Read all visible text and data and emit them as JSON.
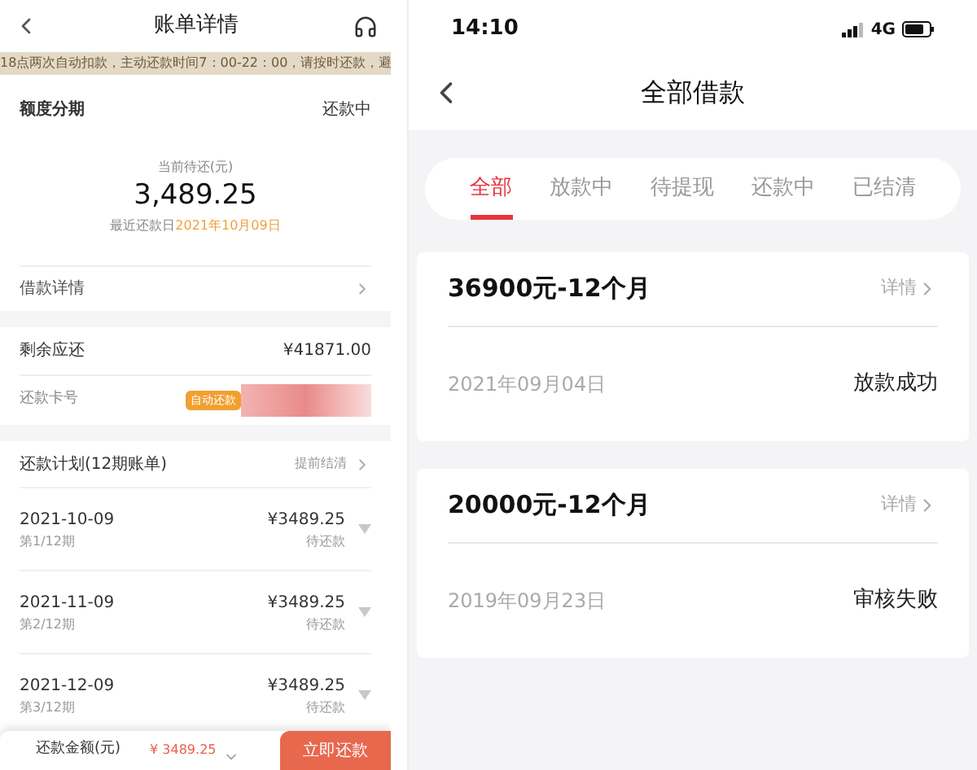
{
  "left": {
    "header": {
      "title": "账单详情"
    },
    "notice": "18点两次自动扣款，主动还款时间7：00-22：00，请按时还款，避",
    "summary": {
      "type": "额度分期",
      "status": "还款中",
      "label": "当前待还(元)",
      "amount": "3,489.25",
      "due_label": "最近还款日",
      "due_date": "2021年10月09日"
    },
    "loan_detail": "借款详情",
    "remaining": {
      "label": "剩余应还",
      "value": "¥41871.00"
    },
    "card": {
      "label": "还款卡号",
      "badge": "自动还款"
    },
    "plan": {
      "title": "还款计划(12期账单)",
      "action": "提前结清",
      "rows": [
        {
          "date": "2021-10-09",
          "period": "第1/12期",
          "amount": "¥3489.25",
          "status": "待还款"
        },
        {
          "date": "2021-11-09",
          "period": "第2/12期",
          "amount": "¥3489.25",
          "status": "待还款"
        },
        {
          "date": "2021-12-09",
          "period": "第3/12期",
          "amount": "¥3489.25",
          "status": "待还款"
        }
      ]
    },
    "footer": {
      "label": "还款金额(元)",
      "amount": "¥ 3489.25",
      "button": "立即还款"
    }
  },
  "right": {
    "status_bar": {
      "time": "14:10",
      "network": "4G"
    },
    "header": {
      "title": "全部借款"
    },
    "tabs": [
      {
        "label": "全部",
        "selected": true
      },
      {
        "label": "放款中",
        "selected": false
      },
      {
        "label": "待提现",
        "selected": false
      },
      {
        "label": "还款中",
        "selected": false
      },
      {
        "label": "已结清",
        "selected": false
      }
    ],
    "loans": [
      {
        "title": "36900元-12个月",
        "detail": "详情",
        "date": "2021年09月04日",
        "status": "放款成功"
      },
      {
        "title": "20000元-12个月",
        "detail": "详情",
        "date": "2019年09月23日",
        "status": "审核失败"
      }
    ]
  }
}
